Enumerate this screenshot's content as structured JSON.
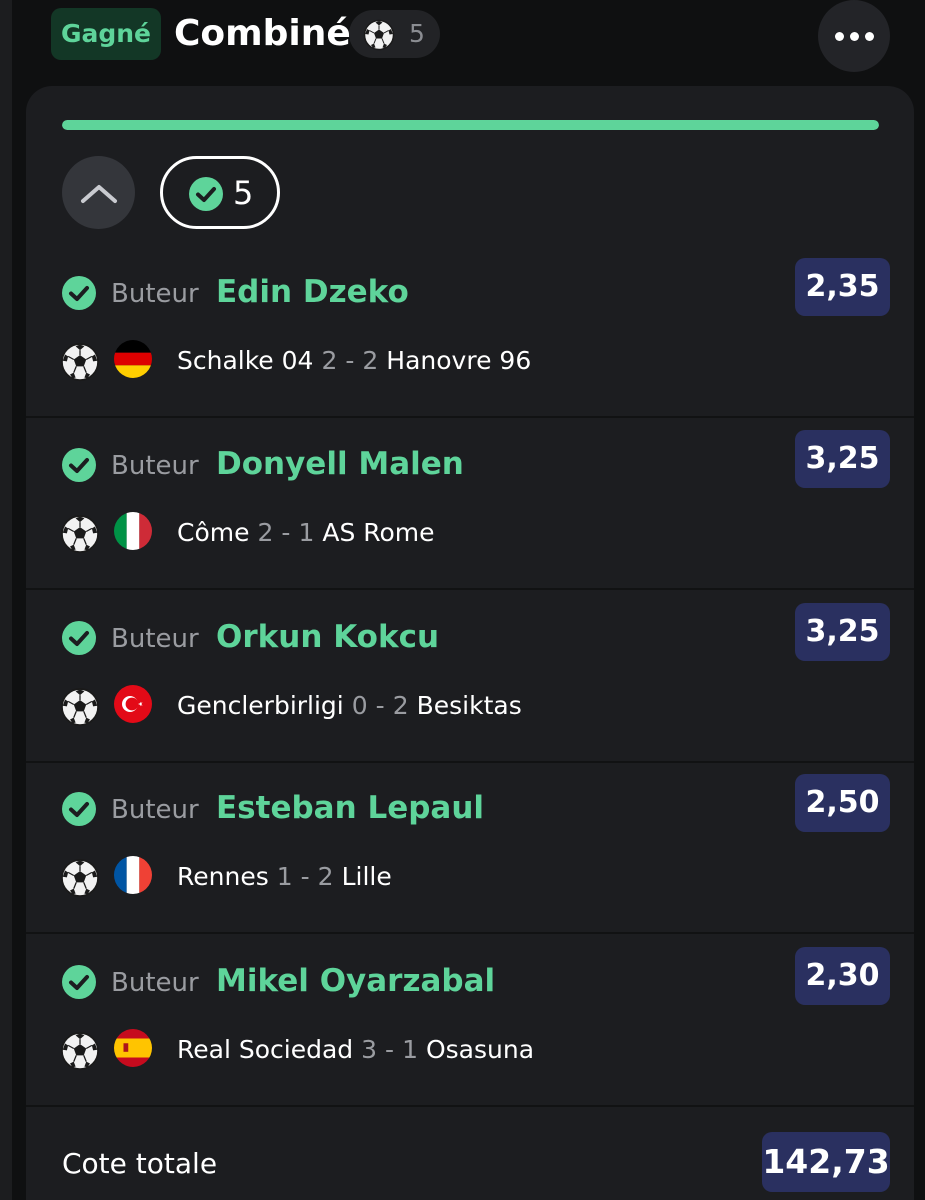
{
  "header": {
    "status_badge": "Gagné",
    "title": "Combiné",
    "selection_count": "5",
    "sport_icon": "soccer-ball-icon",
    "menu_icon": "more-horizontal-icon"
  },
  "card": {
    "progress": 1.0,
    "collapse_icon": "chevron-up-icon",
    "won_count": "5",
    "won_icon": "check-circle-icon"
  },
  "selections": [
    {
      "market": "Buteur",
      "player": "Edin Dzeko",
      "odds": "2,35",
      "flag": "germany",
      "home": "Schalke 04",
      "home_score": "2",
      "sep": "-",
      "away_score": "2",
      "away": "Hanovre 96"
    },
    {
      "market": "Buteur",
      "player": "Donyell Malen",
      "odds": "3,25",
      "flag": "italy",
      "home": "Côme",
      "home_score": "2",
      "sep": "-",
      "away_score": "1",
      "away": "AS Rome"
    },
    {
      "market": "Buteur",
      "player": "Orkun Kokcu",
      "odds": "3,25",
      "flag": "turkey",
      "home": "Genclerbirligi",
      "home_score": "0",
      "sep": "-",
      "away_score": "2",
      "away": "Besiktas"
    },
    {
      "market": "Buteur",
      "player": "Esteban Lepaul",
      "odds": "2,50",
      "flag": "france",
      "home": "Rennes",
      "home_score": "1",
      "sep": "-",
      "away_score": "2",
      "away": "Lille"
    },
    {
      "market": "Buteur",
      "player": "Mikel Oyarzabal",
      "odds": "2,30",
      "flag": "spain",
      "home": "Real Sociedad",
      "home_score": "3",
      "sep": "-",
      "away_score": "1",
      "away": "Osasuna"
    }
  ],
  "total": {
    "label": "Cote totale",
    "odds": "142,73"
  },
  "colors": {
    "accent_green": "#5ed49a",
    "odds_bg": "#2a3060",
    "card_bg": "#1c1d20",
    "page_bg": "#0f1011"
  }
}
